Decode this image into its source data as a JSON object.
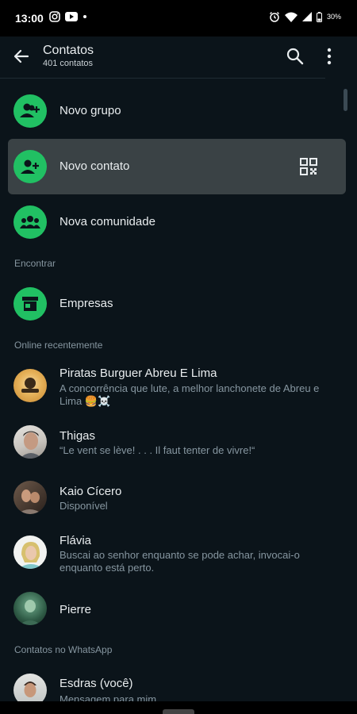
{
  "status_bar": {
    "time": "13:00",
    "battery": "30%"
  },
  "header": {
    "title": "Contatos",
    "subtitle": "401 contatos",
    "back_icon": "arrow-left-icon",
    "search_icon": "search-icon",
    "more_icon": "more-vert-icon"
  },
  "actions": [
    {
      "label": "Novo grupo",
      "icon": "group-add-icon"
    },
    {
      "label": "Novo contato",
      "icon": "person-add-icon"
    },
    {
      "label": "Nova comunidade",
      "icon": "community-icon"
    }
  ],
  "sections": {
    "find": "Encontrar",
    "online": "Online recentemente",
    "on_whatsapp": "Contatos no WhatsApp"
  },
  "businesses": {
    "label": "Empresas",
    "icon": "storefront-icon"
  },
  "contacts": [
    {
      "name": "Piratas Burguer Abreu E Lima",
      "status": "A concorrência que lute, a melhor lanchonete de Abreu e Lima 🍔☠️"
    },
    {
      "name": "Thigas",
      "status": "“Le vent se lève! . . . Il faut tenter de vivre!“"
    },
    {
      "name": "Kaio Cícero",
      "status": "Disponível"
    },
    {
      "name": "Flávia",
      "status": "Buscai ao senhor enquanto se pode achar, invocai-o enquanto está perto."
    },
    {
      "name": "Pierre",
      "status": ""
    }
  ],
  "self_contact": {
    "name": "Esdras (você)",
    "status": "Mensagem para mim"
  },
  "colors": {
    "background": "#0b141a",
    "accent": "#21c063",
    "highlight": "#3a4245"
  }
}
